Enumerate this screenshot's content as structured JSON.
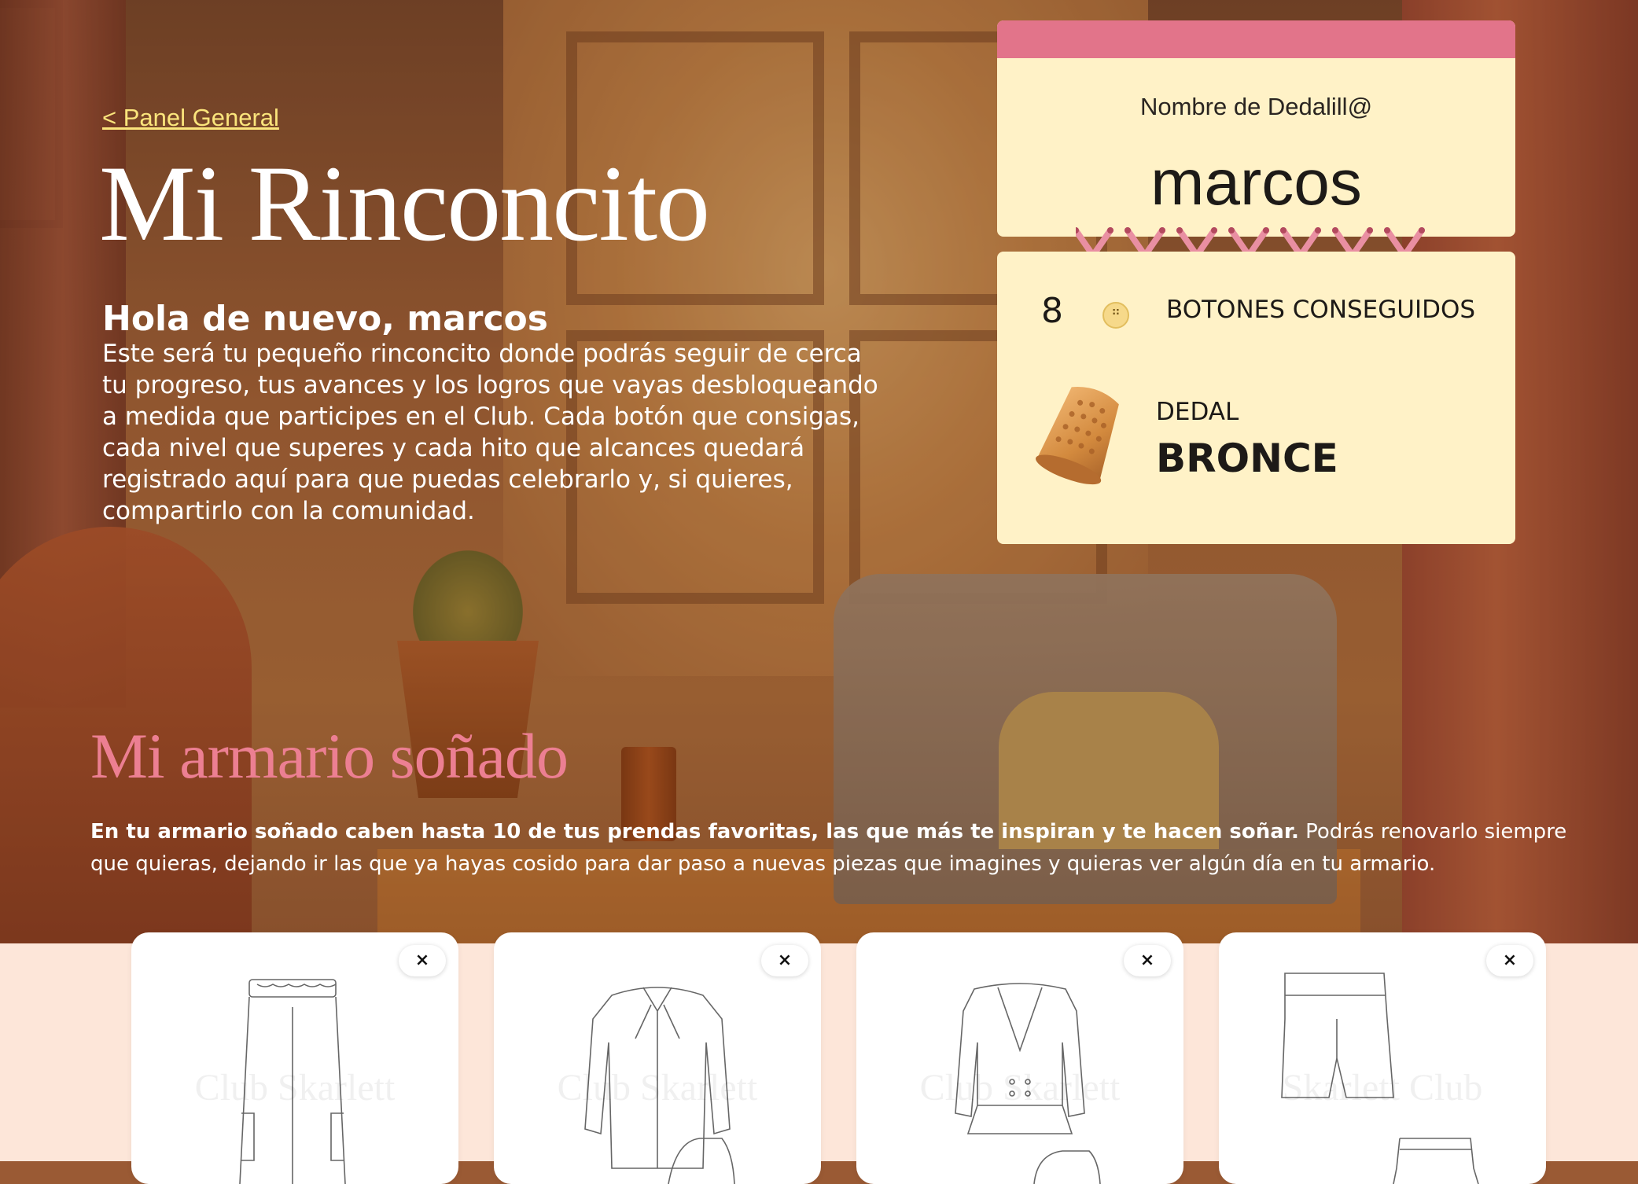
{
  "header": {
    "back_link": "< Panel General",
    "title": "Mi Rinconcito",
    "greeting": "Hola de nuevo, marcos",
    "intro": "Este será tu pequeño rinconcito donde podrás seguir de cerca tu progreso, tus avances y los logros que vayas desbloqueando a medida que participes en el Club. Cada botón que consigas, cada nivel que superes y cada hito que alcances quedará registrado aquí para que puedas celebrarlo y, si quieres, compartirlo con la comunidad."
  },
  "profile": {
    "name_label": "Nombre de Dedalill@",
    "name": "marcos"
  },
  "stats": {
    "buttons_count": "8",
    "buttons_label": "BOTONES CONSEGUIDOS",
    "dedal_label": "DEDAL",
    "dedal_level": "BRONCE"
  },
  "wardrobe": {
    "title": "Mi armario soñado",
    "desc_bold": "En tu armario soñado caben hasta 10 de tus prendas favoritas, las que más te inspiran y te hacen soñar.",
    "desc_rest": " Podrás renovarlo siempre que quieras, dejando ir las que ya hayas cosido para dar paso a nuevas piezas que imagines y quieras ver algún día en tu armario.",
    "close_label": "×",
    "items": [
      {
        "icon": "cargo-pants-icon",
        "watermark": "Club Skarlett"
      },
      {
        "icon": "bow-blouse-icon",
        "watermark": "Club Skarlett"
      },
      {
        "icon": "peplum-jacket-icon",
        "watermark": "Club Skarlett"
      },
      {
        "icon": "shorts-icon",
        "watermark": "Skarlett Club"
      }
    ]
  },
  "colors": {
    "accent_pink": "#e2748a",
    "title_pink": "#ec7f92",
    "card_cream": "#fff2c7",
    "link_yellow": "#fbe57c",
    "band_peach": "#fde6d9"
  }
}
